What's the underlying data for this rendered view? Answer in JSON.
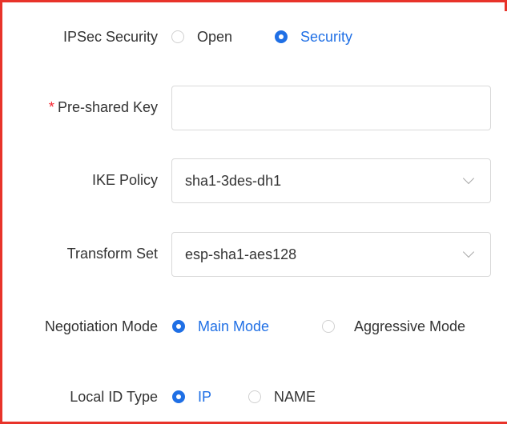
{
  "form": {
    "ipsec_security": {
      "label": "IPSec Security",
      "options": [
        "Open",
        "Security"
      ],
      "selected": "Security"
    },
    "pre_shared_key": {
      "required_mark": "*",
      "label": "Pre-shared Key",
      "value": "",
      "placeholder": ""
    },
    "ike_policy": {
      "label": "IKE Policy",
      "value": "sha1-3des-dh1"
    },
    "transform_set": {
      "label": "Transform Set",
      "value": "esp-sha1-aes128"
    },
    "negotiation_mode": {
      "label": "Negotiation Mode",
      "options": [
        "Main Mode",
        "Aggressive Mode"
      ],
      "selected": "Main Mode"
    },
    "local_id_type": {
      "label": "Local ID Type",
      "options": [
        "IP",
        "NAME"
      ],
      "selected": "IP"
    }
  },
  "colors": {
    "accent": "#1f6fe5",
    "required": "#f5222d",
    "frame": "#e8332a",
    "text": "#333333"
  },
  "icons": {
    "select_arrow": "chevron-down-icon"
  }
}
